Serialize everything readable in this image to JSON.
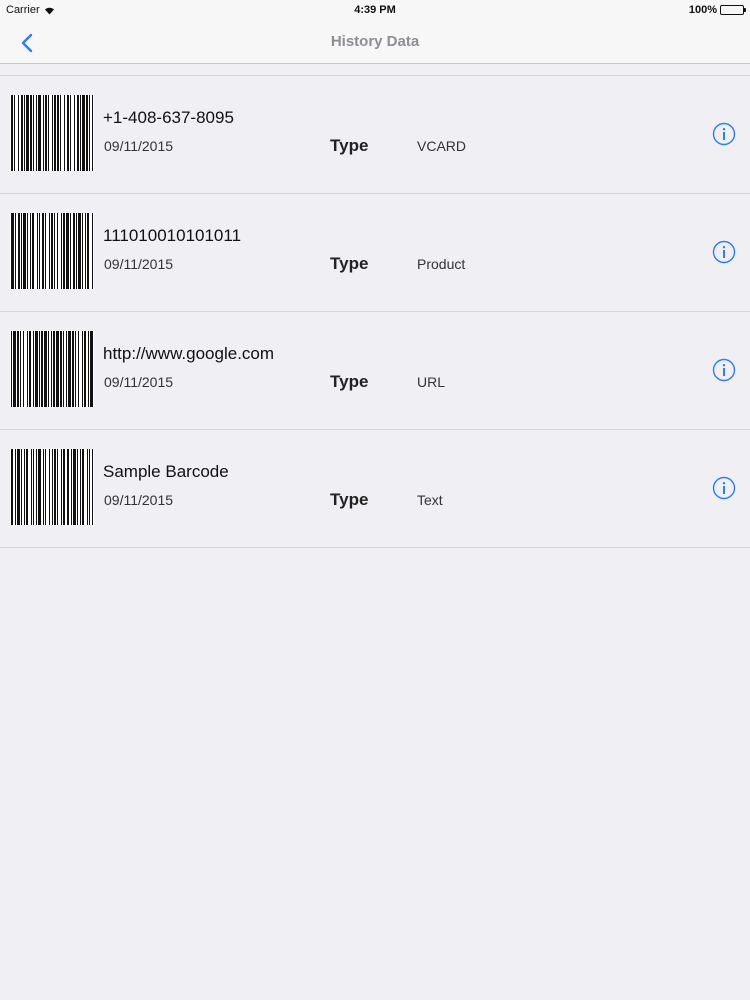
{
  "status_bar": {
    "carrier": "Carrier",
    "time": "4:39 PM",
    "battery": "100%"
  },
  "nav": {
    "title": "History Data",
    "back_icon": "chevron-left-icon",
    "accent_color": "#2f7cf6"
  },
  "history": {
    "type_label": "Type",
    "items": [
      {
        "title": "+1-408-637-8095",
        "date": "09/11/2015",
        "type": "VCARD"
      },
      {
        "title": "111010010101011",
        "date": "09/11/2015",
        "type": "Product"
      },
      {
        "title": "http://www.google.com",
        "date": "09/11/2015",
        "type": "URL"
      },
      {
        "title": "Sample Barcode",
        "date": "09/11/2015",
        "type": "Text"
      }
    ]
  }
}
